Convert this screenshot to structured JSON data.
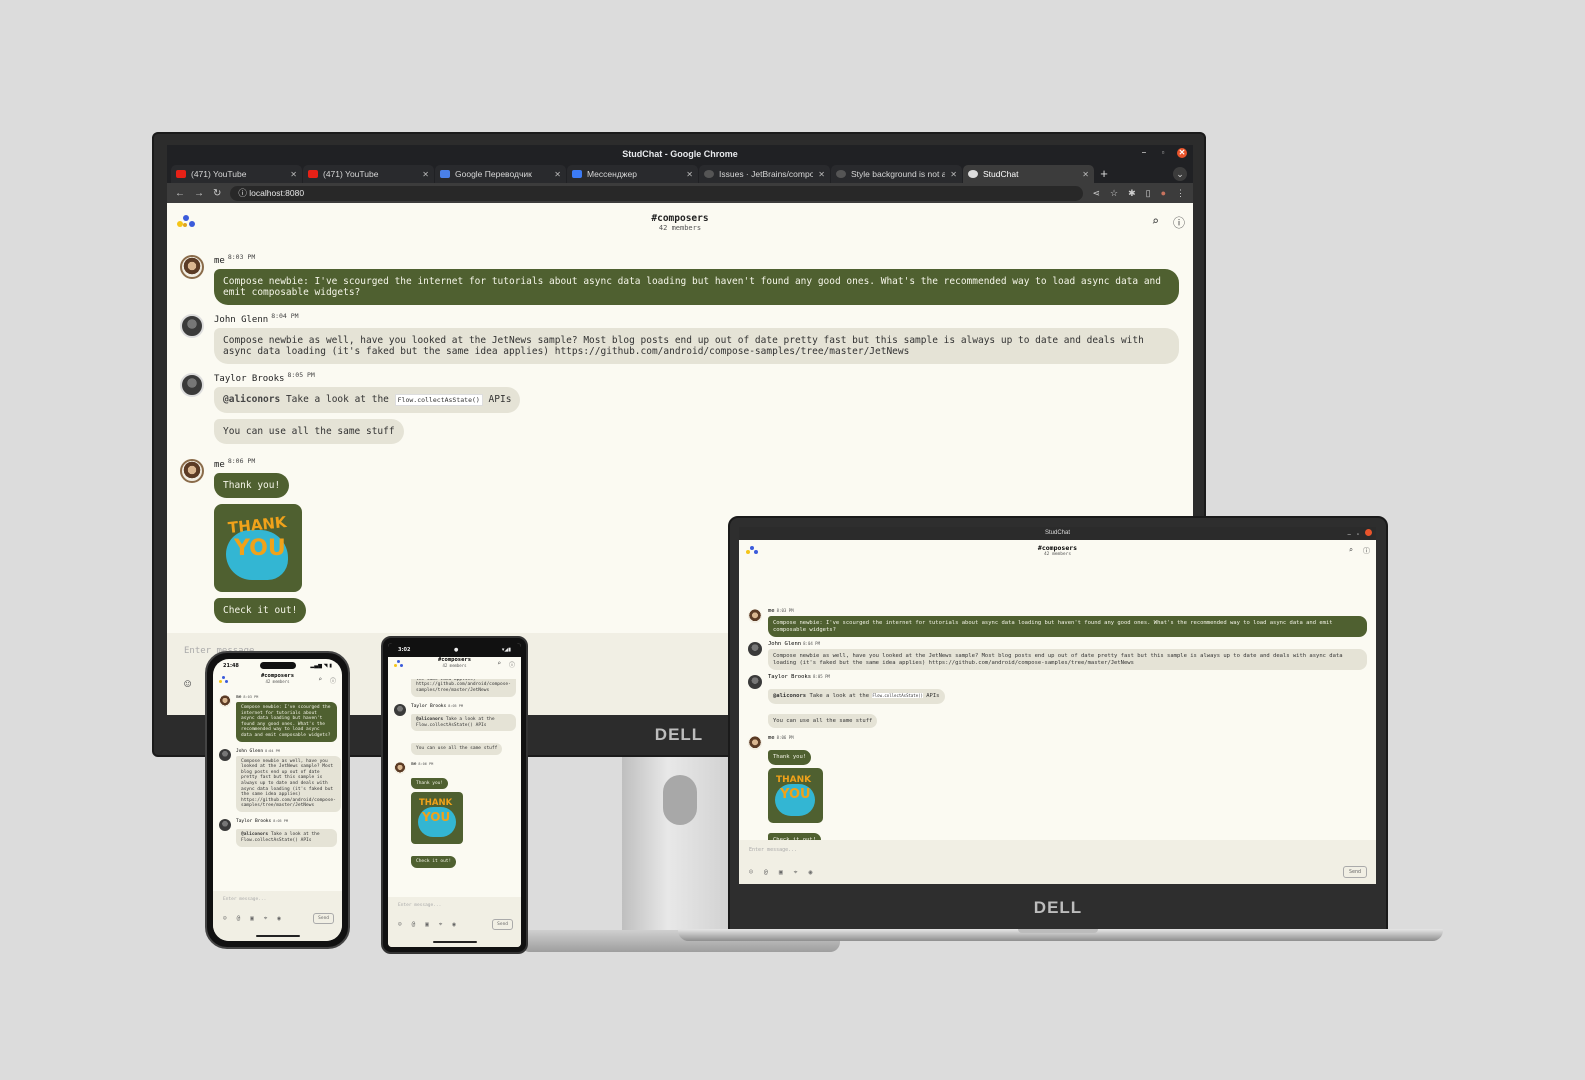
{
  "chrome": {
    "window_title": "StudChat - Google Chrome",
    "tabs": [
      {
        "label": "(471) YouTube",
        "favicon_color": "#e62117"
      },
      {
        "label": "(471) YouTube",
        "favicon_color": "#e62117"
      },
      {
        "label": "Google Переводчик",
        "favicon_color": "#4a80e8"
      },
      {
        "label": "Мессенджер",
        "favicon_color": "#3c7bf5"
      },
      {
        "label": "Issues · JetBrains/compo",
        "favicon_color": "#555555"
      },
      {
        "label": "Style background is not a",
        "favicon_color": "#555555"
      },
      {
        "label": "StudChat",
        "favicon_color": "#dddddd"
      }
    ],
    "url": "localhost:8080"
  },
  "app": {
    "channel": "#composers",
    "members": "42 members",
    "accent_color": "#4f6030",
    "messages": {
      "m1": {
        "author": "me",
        "time": "8:03 PM",
        "text": "Compose newbie: I've scourged the internet for tutorials about async data loading but haven't found any good ones. What's the recommended way to load async data and emit composable widgets?"
      },
      "m2": {
        "author": "John Glenn",
        "time": "8:04 PM",
        "text": "Compose newbie as well, have you looked at the JetNews sample? Most blog posts end up out of date pretty fast but this sample is always up to date and deals with async data loading (it's faked but the same idea applies) https://github.com/android/compose-samples/tree/master/JetNews"
      },
      "m3": {
        "author": "Taylor Brooks",
        "time": "8:05 PM",
        "mention": "@aliconors",
        "text_a": "Take a look at the",
        "code": "Flow.collectAsState()",
        "text_b": "APIs",
        "text2": "You can use all the same stuff"
      },
      "m4": {
        "author": "me",
        "time": "8:06 PM",
        "text": "Thank you!",
        "sticker_line1": "THANK",
        "sticker_line2": "YOU",
        "text2": "Check it out!"
      }
    },
    "composer": {
      "placeholder": "Enter message...",
      "send_label": "Send"
    }
  },
  "laptop": {
    "window_title": "StudChat"
  },
  "iphone": {
    "time": "21:48"
  },
  "android": {
    "time": "3:02"
  },
  "brand": "DELL"
}
